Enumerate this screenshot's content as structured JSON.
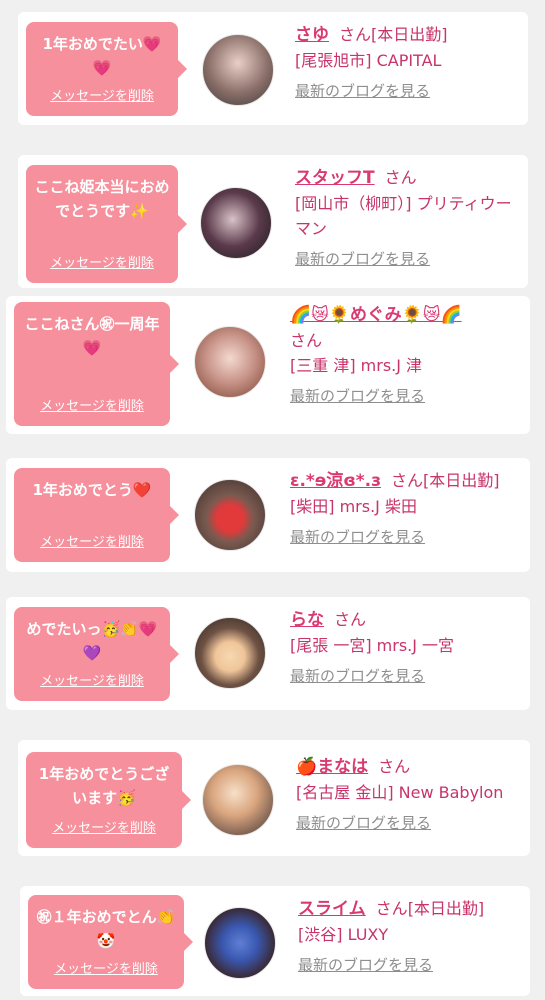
{
  "cards": [
    {
      "message": "1年おめでたい💗💗",
      "delete_label": "メッセージを削除",
      "name": "さゆ",
      "honorific": "さん",
      "status": "[本日出勤]",
      "shop": "[尾張旭市] CAPITAL",
      "blog_label": "最新のブログを見る"
    },
    {
      "message": "ここね姫本当におめでとうです✨",
      "delete_label": "メッセージを削除",
      "name": "スタッフT",
      "honorific": "さん",
      "status": "",
      "shop": "[岡山市（柳町）] プリティウーマン",
      "blog_label": "最新のブログを見る"
    },
    {
      "message": "ここねさん㊗一周年💗",
      "delete_label": "メッセージを削除",
      "name": "🌈😿🌻めぐみ🌻😿🌈",
      "honorific": "さん",
      "status": "",
      "shop": "[三重 津] mrs.J 津",
      "blog_label": "最新のブログを見る"
    },
    {
      "message": "1年おめでとう❤️",
      "delete_label": "メッセージを削除",
      "name": "ε.*ɘ涼ɞ*.з",
      "honorific": "さん",
      "status": "[本日出勤]",
      "shop": "[柴田] mrs.J 柴田",
      "blog_label": "最新のブログを見る"
    },
    {
      "message": "めでたいっ🥳👏💗💜",
      "delete_label": "メッセージを削除",
      "name": "らな",
      "honorific": "さん",
      "status": "",
      "shop": "[尾張 一宮] mrs.J 一宮",
      "blog_label": "最新のブログを見る"
    },
    {
      "message": "1年おめでとうございます🥳",
      "delete_label": "メッセージを削除",
      "name": "🍎まなは",
      "honorific": "さん",
      "status": "",
      "shop": "[名古屋 金山] New Babylon",
      "blog_label": "最新のブログを見る"
    },
    {
      "message": "㊗１年おめでとん👏🤡",
      "delete_label": "メッセージを削除",
      "name": "スライム",
      "honorific": "さん",
      "status": "[本日出勤]",
      "shop": "[渋谷] LUXY",
      "blog_label": "最新のブログを見る"
    }
  ],
  "colors": {
    "bubble": "#f5909c",
    "accent": "#d93a72",
    "muted": "#8e8e8e",
    "background": "#f1f0f0"
  }
}
